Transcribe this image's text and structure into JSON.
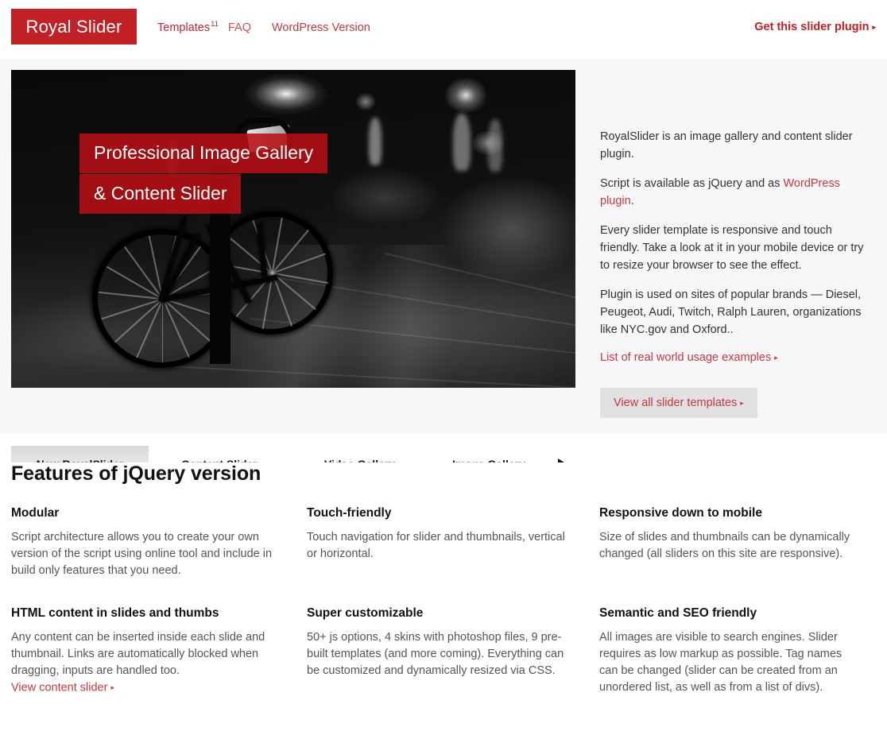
{
  "header": {
    "logo_text": "Royal Slider",
    "logo_bg": "#c12027",
    "nav": [
      {
        "label": "Templates",
        "sup": "11"
      },
      {
        "label": "FAQ",
        "sup": ""
      },
      {
        "label": "WordPress Version",
        "sup": ""
      }
    ],
    "cta_label": "Get this slider plugin",
    "arrow": "▸"
  },
  "slider": {
    "caption_line1": "Professional Image Gallery",
    "caption_line2": "& Content Slider",
    "caption_bg": "#b70f16",
    "tabs": [
      {
        "label": "New RoyalSlider",
        "active": true
      },
      {
        "label": "Content Slider",
        "active": false
      },
      {
        "label": "Video Gallery",
        "active": false
      },
      {
        "label": "Image Gallery",
        "active": false
      }
    ],
    "next_icon": "triangle-right-icon"
  },
  "info": {
    "p1": "RoyalSlider is an image gallery and content slider plugin.",
    "p2_before": "Script is available as jQuery and as ",
    "p2_link": "WordPress plugin",
    "p2_after": ".",
    "p3": "Every slider template is responsive and touch friendly. Take a look at it in your mobile device or try to resize your browser to see the effect.",
    "p4": "Plugin is used on sites of popular brands — Diesel, Peugeot, Audi, Twitch, Ralph Lauren, organizations like NYC.gov and Oxford..",
    "usage_link": "List of real world usage examples",
    "button_label": "View all slider templates",
    "arrow": "▸",
    "link_color": "#c7383f"
  },
  "features": {
    "heading": "Features of jQuery version",
    "items": [
      {
        "title": "Modular",
        "body": "Script architecture allows you to create your own version of the script using online tool and include in build only features that you need.",
        "link": ""
      },
      {
        "title": "Touch-friendly",
        "body": "Touch navigation for slider and thumbnails, vertical or horizontal.",
        "link": ""
      },
      {
        "title": "Responsive down to mobile",
        "body": "Size of slides and thumbnails can be dynamically changed (all sliders on this site are responsive).",
        "link": ""
      },
      {
        "title": "HTML content in slides and thumbs",
        "body": "Any content can be inserted inside each slide and thumbnail. Links are automatically blocked when dragging, inputs are handled too.",
        "link": "View content slider"
      },
      {
        "title": "Super customizable",
        "body": "50+ js options, 4 skins with photoshop files, 9 pre-built templates (and more coming). Everything can be customized and dynamically resized via CSS.",
        "link": ""
      },
      {
        "title": "Semantic and SEO friendly",
        "body": "All images are visible to search engines. Slider requires as low markup as possible. Tag names can be changed (slider can be created from an unordered list, as well as from a list of divs).",
        "link": ""
      }
    ]
  }
}
